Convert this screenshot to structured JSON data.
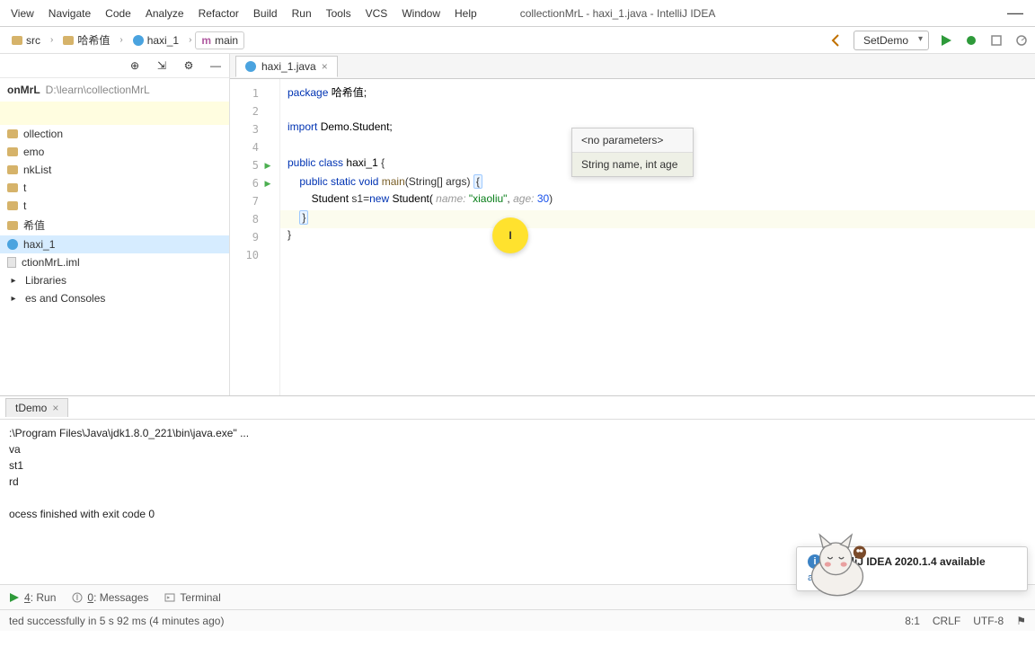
{
  "window": {
    "title": "collectionMrL - haxi_1.java - IntelliJ IDEA"
  },
  "menu": {
    "view": "View",
    "navigate": "Navigate",
    "code": "Code",
    "analyze": "Analyze",
    "refactor": "Refactor",
    "build": "Build",
    "run": "Run",
    "tools": "Tools",
    "vcs": "VCS",
    "window": "Window",
    "help": "Help"
  },
  "breadcrumb": {
    "src": "src",
    "pkg": "哈希值",
    "cls": "haxi_1",
    "method": "main"
  },
  "run_config": {
    "selected": "SetDemo"
  },
  "project": {
    "root_name": "onMrL",
    "root_path": "D:\\learn\\collectionMrL",
    "items": [
      "ollection",
      "emo",
      "nkList",
      "t",
      "t",
      "希值",
      "haxi_1",
      "ctionMrL.iml",
      "Libraries",
      "es and Consoles"
    ]
  },
  "editor": {
    "tab_label": "haxi_1.java",
    "lines_count": 10,
    "code": {
      "pkg_kw": "package",
      "pkg_name": "哈希值;",
      "imp_kw": "import",
      "imp_name": "Demo.Student;",
      "pub": "public",
      "cls": "class",
      "cls_name": "haxi_1",
      "ob": "{",
      "stat": "static",
      "void": "void",
      "main": "main",
      "args": "(String[] args)",
      "stu_type": "Student",
      "s1": "s1",
      "eqnew": "=",
      "new_kw": "new",
      "stu_ctor": "Student(",
      "hint_name": "name:",
      "val_name": "\"xiaoliu\"",
      "comma": ",",
      "hint_age": "age:",
      "val_age": "30",
      "cp": ")",
      "cb1": "}",
      "cb2": "}"
    },
    "param_popup": {
      "r1": "<no parameters>",
      "r2": "String name, int age"
    },
    "cursor_mark": "I"
  },
  "run_tool": {
    "tab": "tDemo",
    "lines": [
      ":\\Program Files\\Java\\jdk1.8.0_221\\bin\\java.exe\" ...",
      "va",
      "st1",
      "rd",
      "",
      "ocess finished with exit code 0"
    ]
  },
  "toolwindows": {
    "run_u": "4",
    "run": ": Run",
    "msg_u": "0",
    "msg": ": Messages",
    "term": "Terminal"
  },
  "status": {
    "left": "ted successfully in 5 s 92 ms (4 minutes ago)",
    "pos": "8:1",
    "crlf": "CRLF",
    "enc": "UTF-8"
  },
  "notification": {
    "title": "IntelliJ IDEA 2020.1.4 available",
    "link": "ate..."
  }
}
